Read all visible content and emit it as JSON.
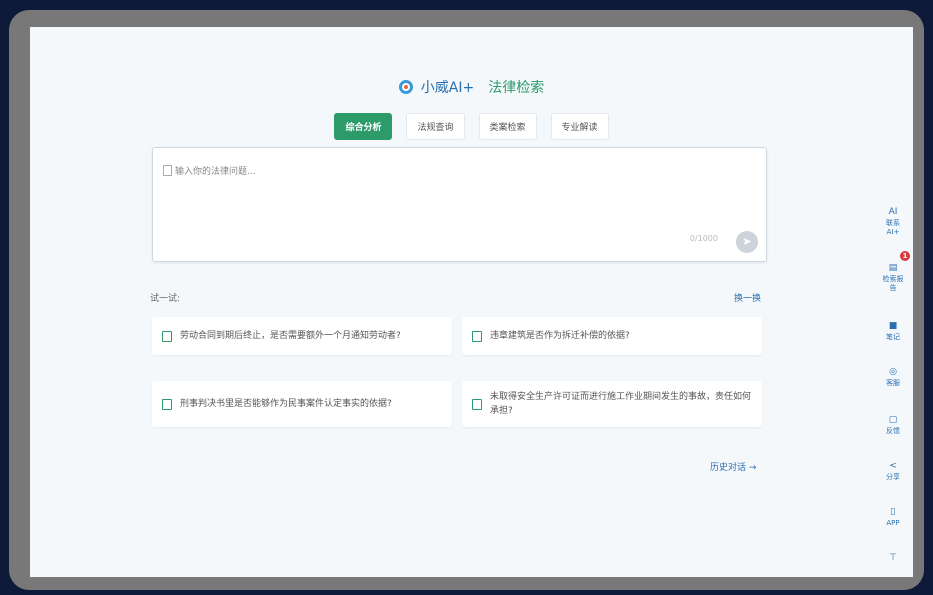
{
  "header": {
    "brand": "小威AI+",
    "subtitle": "法律检索"
  },
  "tabs": [
    {
      "label": "综合分析"
    },
    {
      "label": "法规查询"
    },
    {
      "label": "类案检索"
    },
    {
      "label": "专业解读"
    }
  ],
  "query": {
    "placeholder": "输入你的法律问题...",
    "counter": "0/1000",
    "send_icon": "send-icon"
  },
  "suggestions": {
    "title": "试一试:",
    "refresh": "换一换",
    "items": [
      "劳动合同到期后终止，是否需要额外一个月通知劳动者?",
      "违章建筑是否作为拆迁补偿的依据?",
      "刑事判决书里是否能够作为民事案件认定事实的依据?",
      "未取得安全生产许可证而进行施工作业期间发生的事故，责任如何承担?"
    ]
  },
  "history": "历史对话 →",
  "sidebar": [
    {
      "icon": "AI",
      "label": "联系AI+"
    },
    {
      "icon": "▤",
      "label": "检索报告",
      "badge": "1"
    },
    {
      "icon": "■",
      "label": "笔记"
    },
    {
      "icon": "◎",
      "label": "客服"
    },
    {
      "icon": "▢",
      "label": "反馈"
    },
    {
      "icon": "<",
      "label": "分享"
    },
    {
      "icon": "▯",
      "label": "APP"
    },
    {
      "icon": "⊤",
      "label": ""
    }
  ]
}
